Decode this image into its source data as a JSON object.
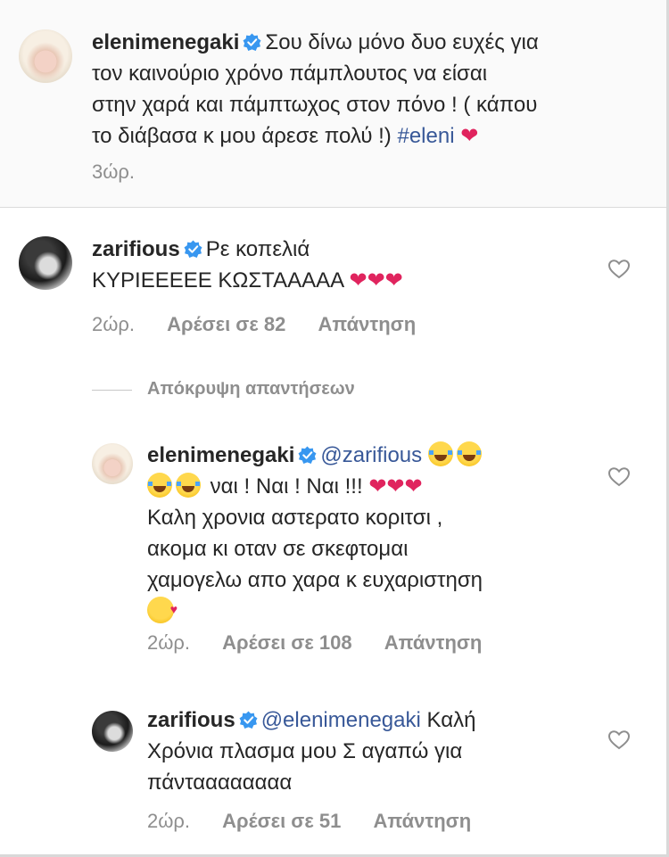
{
  "caption": {
    "username": "elenimenegaki",
    "text_lines": [
      "Σου δίνω μόνο δυο ευχές  για",
      "τον καινούριο χρόνο  πάμπλουτος να είσαι",
      "στην χαρά  και πάμπτωχος στον πόνο ! ( κάπου",
      "το διάβασα κ μου άρεσε πολύ !)"
    ],
    "hashtag": "#eleni",
    "time": "3ώρ."
  },
  "comment1": {
    "username": "zarifious",
    "line1": "Ρε κοπελιά",
    "line2": "ΚΥΡΙΕΕΕΕΕ ΚΩΣΤΑΑΑΑΑ",
    "time": "2ώρ.",
    "likes": "Αρέσει σε 82",
    "reply": "Απάντηση"
  },
  "hide_replies": "Απόκρυψη απαντήσεων",
  "reply1": {
    "username": "elenimenegaki",
    "mention": "@zarifious",
    "line2": "ναι ! Ναι ! Ναι !!!",
    "line3": "Καλη χρονια αστερατο κοριτσι ,",
    "line4": "ακομα κι οταν σε σκεφτομαι",
    "line5": "χαμογελω απο χαρα κ ευχαριστηση",
    "time": "2ώρ.",
    "likes": "Αρέσει σε 108",
    "reply": "Απάντηση"
  },
  "reply2": {
    "username": "zarifious",
    "mention": "@elenimenegaki",
    "line1_rest": "Καλή",
    "line2": "Χρόνια πλασμα μου Σ αγαπώ για",
    "line3": "πάνταααααααα",
    "time": "2ώρ.",
    "likes": "Αρέσει σε 51",
    "reply": "Απάντηση"
  },
  "icons": {
    "verified": "verified-badge-icon",
    "heart_emoji": "red-heart-emoji",
    "like": "heart-outline-icon",
    "laugh": "tears-of-joy-emoji",
    "kiss": "face-blowing-kiss-emoji"
  },
  "colors": {
    "verified_blue": "#3897f0",
    "link_blue": "#385898",
    "heart_red": "#e0245e",
    "meta_gray": "#8e8e8e"
  }
}
